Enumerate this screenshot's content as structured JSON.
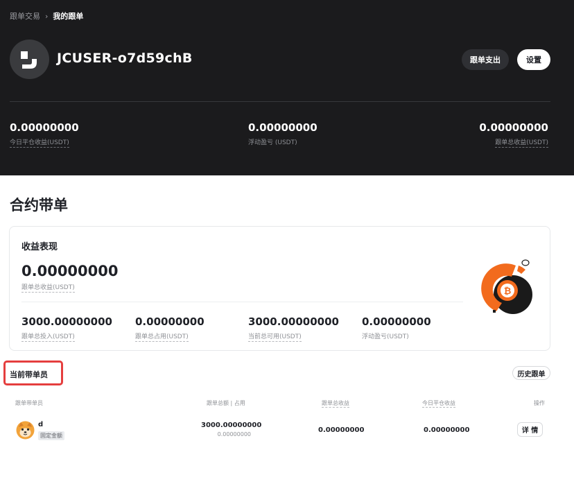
{
  "breadcrumb": {
    "parent": "跟单交易",
    "separator": "›",
    "current": "我的跟单"
  },
  "user": {
    "name": "JCUSER-o7d59chB"
  },
  "header_buttons": {
    "expense": "跟单支出",
    "settings": "设置"
  },
  "header_stats": [
    {
      "value": "0.00000000",
      "label": "今日平仓收益(USDT)"
    },
    {
      "value": "0.00000000",
      "label": "浮动盈亏 (USDT)"
    },
    {
      "value": "0.00000000",
      "label": "跟单总收益(USDT)"
    }
  ],
  "section": {
    "title": "合约带单"
  },
  "performance": {
    "title": "收益表现",
    "total": {
      "value": "0.00000000",
      "label": "跟单总收益(USDT)"
    },
    "stats": [
      {
        "value": "3000.00000000",
        "label": "跟单总投入(USDT)"
      },
      {
        "value": "0.00000000",
        "label": "跟单总占用(USDT)"
      },
      {
        "value": "3000.00000000",
        "label": "当前总可用(USDT)"
      },
      {
        "value": "0.00000000",
        "label": "浮动盈亏(USDT)"
      }
    ]
  },
  "leaders": {
    "title": "当前带单员",
    "history_button": "历史跟单",
    "columns": [
      "跟单带单员",
      "跟单总额 | 占用",
      "跟单总收益",
      "今日平仓收益",
      "操作"
    ],
    "rows": [
      {
        "name": "d",
        "tag": "固定金额",
        "amount": "3000.00000000",
        "occupied": "0.00000000",
        "total_profit": "0.00000000",
        "today_profit": "0.00000000",
        "action": "详 情"
      }
    ]
  },
  "colors": {
    "hero_bg": "#1b1b1d",
    "accent_orange": "#f26b1d",
    "highlight_red": "#e53e3e"
  },
  "icons": {
    "avatar": "brand-logo-icon",
    "illustration": "bitcoin-coin-icon",
    "leader_avatar": "shiba-dog-icon"
  }
}
